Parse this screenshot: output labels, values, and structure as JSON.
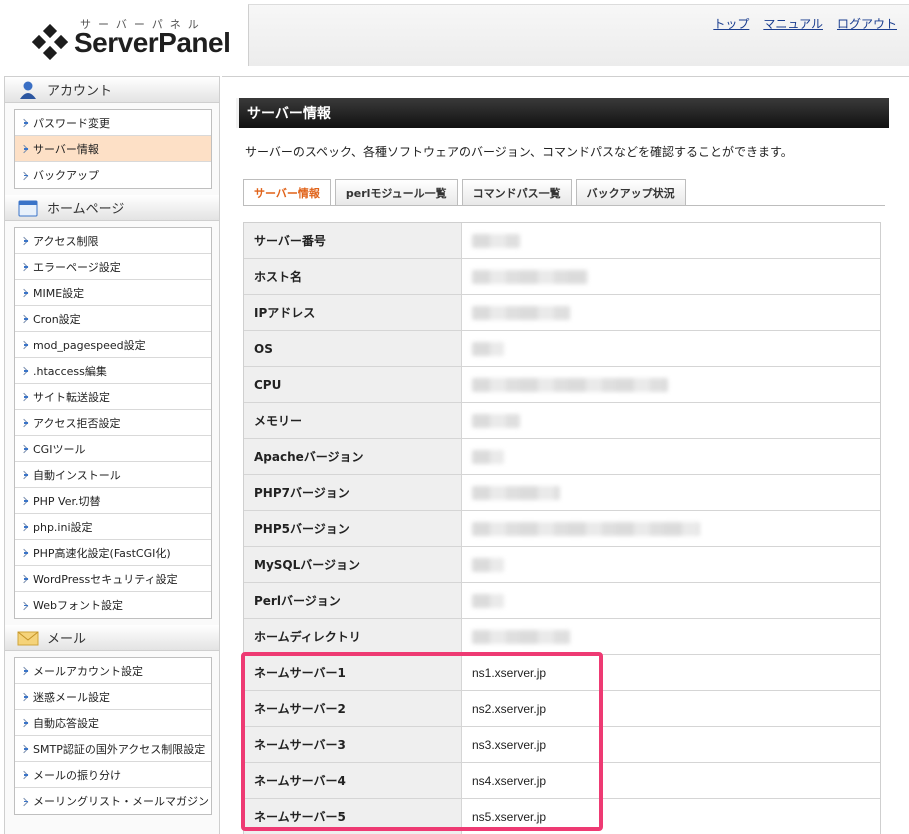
{
  "logo": {
    "subtitle": "サーバーパネル",
    "title": "ServerPanel"
  },
  "toplinks": [
    "トップ",
    "マニュアル",
    "ログアウト"
  ],
  "sidebar": {
    "sections": [
      {
        "title": "アカウント",
        "icon": "person-icon",
        "items": [
          "パスワード変更",
          "サーバー情報",
          "バックアップ"
        ],
        "active": 1
      },
      {
        "title": "ホームページ",
        "icon": "browser-window-icon",
        "items": [
          "アクセス制限",
          "エラーページ設定",
          "MIME設定",
          "Cron設定",
          "mod_pagespeed設定",
          ".htaccess編集",
          "サイト転送設定",
          "アクセス拒否設定",
          "CGIツール",
          "自動インストール",
          "PHP Ver.切替",
          "php.ini設定",
          "PHP高速化設定(FastCGI化)",
          "WordPressセキュリティ設定",
          "Webフォント設定"
        ],
        "active": -1
      },
      {
        "title": "メール",
        "icon": "envelope-icon",
        "items": [
          "メールアカウント設定",
          "迷惑メール設定",
          "自動応答設定",
          "SMTP認証の国外アクセス制限設定",
          "メールの振り分け",
          "メーリングリスト・メールマガジン"
        ],
        "active": -1
      }
    ]
  },
  "main": {
    "title": "サーバー情報",
    "description": "サーバーのスペック、各種ソフトウェアのバージョン、コマンドパスなどを確認することができます。",
    "tabs": [
      "サーバー情報",
      "perlモジュール一覧",
      "コマンドパス一覧",
      "バックアップ状況"
    ],
    "active_tab": 0,
    "rows": [
      {
        "label": "サーバー番号",
        "value": "",
        "redacted": true
      },
      {
        "label": "ホスト名",
        "value": "",
        "redacted": true
      },
      {
        "label": "IPアドレス",
        "value": "",
        "redacted": true
      },
      {
        "label": "OS",
        "value": "",
        "redacted": true
      },
      {
        "label": "CPU",
        "value": "",
        "redacted": true
      },
      {
        "label": "メモリー",
        "value": "",
        "redacted": true
      },
      {
        "label": "Apacheバージョン",
        "value": "",
        "redacted": true
      },
      {
        "label": "PHP7バージョン",
        "value": "",
        "redacted": true
      },
      {
        "label": "PHP5バージョン",
        "value": "",
        "redacted": true
      },
      {
        "label": "MySQLバージョン",
        "value": "",
        "redacted": true
      },
      {
        "label": "Perlバージョン",
        "value": "",
        "redacted": true
      },
      {
        "label": "ホームディレクトリ",
        "value": "",
        "redacted": true
      },
      {
        "label": "ネームサーバー1",
        "value": "ns1.xserver.jp",
        "redacted": false
      },
      {
        "label": "ネームサーバー2",
        "value": "ns2.xserver.jp",
        "redacted": false
      },
      {
        "label": "ネームサーバー3",
        "value": "ns3.xserver.jp",
        "redacted": false
      },
      {
        "label": "ネームサーバー4",
        "value": "ns4.xserver.jp",
        "redacted": false
      },
      {
        "label": "ネームサーバー5",
        "value": "ns5.xserver.jp",
        "redacted": false
      }
    ]
  },
  "colors": {
    "highlight": "#ee3a73",
    "active_tab_text": "#e0631a",
    "active_item_bg": "#fde0c6",
    "link": "#1a3d8f"
  }
}
